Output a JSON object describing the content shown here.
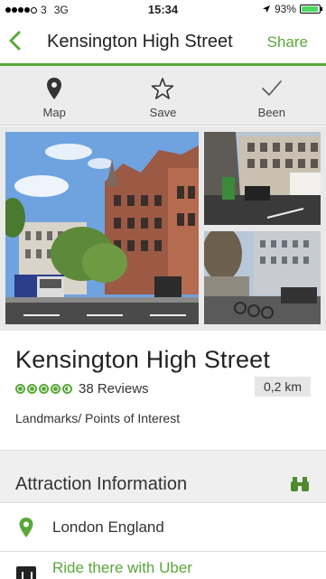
{
  "status_bar": {
    "carrier": "3",
    "network": "3G",
    "time": "15:34",
    "battery": "93%",
    "battery_level": 0.93
  },
  "nav": {
    "title": "Kensington High Street",
    "share_label": "Share",
    "accent_color": "#5aa83a"
  },
  "actions": [
    {
      "label": "Map",
      "icon": "map-pin-icon"
    },
    {
      "label": "Save",
      "icon": "star-icon"
    },
    {
      "label": "Been",
      "icon": "checkmark-icon"
    }
  ],
  "place": {
    "name": "Kensington High Street",
    "rating": 4.5,
    "reviews": "38 Reviews",
    "distance": "0,2 km",
    "category": "Landmarks/ Points of Interest"
  },
  "section": {
    "title": "Attraction Information",
    "icon": "binoculars-icon"
  },
  "rows": {
    "location": "London England",
    "uber": "Ride there with Uber"
  }
}
